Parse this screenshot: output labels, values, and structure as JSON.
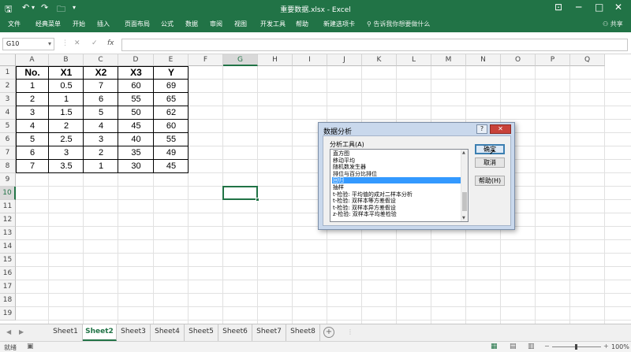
{
  "title": "重要数据.xlsx  -  Excel",
  "quick_access": {
    "save": "🖫",
    "undo": "↶",
    "redo": "↷",
    "more": "▾"
  },
  "window_controls": {
    "ribbon_opts": "⊡",
    "minimize": "─",
    "maximize": "□",
    "close": "✕"
  },
  "ribbon_tabs": [
    "文件",
    "经典菜单",
    "开始",
    "插入",
    "页面布局",
    "公式",
    "数据",
    "审阅",
    "视图",
    "开发工具",
    "帮助",
    "新建选项卡"
  ],
  "tell_me": "告诉我你想要做什么",
  "share": "共享",
  "formula_bar": {
    "name_box": "G10",
    "cancel": "✕",
    "enter": "✓",
    "fx": "fx",
    "formula": ""
  },
  "columns": [
    "A",
    "B",
    "C",
    "D",
    "E",
    "F",
    "G",
    "H",
    "I",
    "J",
    "K",
    "L",
    "M",
    "N",
    "O",
    "P",
    "Q"
  ],
  "rows": [
    "1",
    "2",
    "3",
    "4",
    "5",
    "6",
    "7",
    "8",
    "9",
    "10",
    "11",
    "12",
    "13",
    "14",
    "15",
    "16",
    "17",
    "18",
    "19"
  ],
  "selected_cell": "G10",
  "table": {
    "headers": [
      "No.",
      "X1",
      "X2",
      "X3",
      "Y"
    ],
    "rows": [
      [
        "1",
        "0.5",
        "7",
        "60",
        "69"
      ],
      [
        "2",
        "1",
        "6",
        "55",
        "65"
      ],
      [
        "3",
        "1.5",
        "5",
        "50",
        "62"
      ],
      [
        "4",
        "2",
        "4",
        "45",
        "60"
      ],
      [
        "5",
        "2.5",
        "3",
        "40",
        "55"
      ],
      [
        "6",
        "3",
        "2",
        "35",
        "49"
      ],
      [
        "7",
        "3.5",
        "1",
        "30",
        "45"
      ]
    ]
  },
  "dialog": {
    "title": "数据分析",
    "help": "?",
    "close": "✕",
    "label": "分析工具(A)",
    "tools": [
      "直方图",
      "移动平均",
      "随机数发生器",
      "排位与百分比排位",
      "回归",
      "抽样",
      "t-检验: 平均值的成对二样本分析",
      "t-检验: 双样本等方差假设",
      "t-检验: 双样本异方差假设",
      "z-检验: 双样本平均差检验"
    ],
    "selected_tool": "回归",
    "ok": "确定",
    "cancel": "取消",
    "help_button": "帮助(H)"
  },
  "sheets": [
    "Sheet1",
    "Sheet2",
    "Sheet3",
    "Sheet4",
    "Sheet5",
    "Sheet6",
    "Sheet7",
    "Sheet8"
  ],
  "active_sheet": "Sheet2",
  "status": {
    "ready": "就绪",
    "zoom": "100%"
  },
  "colors": {
    "excel_green": "#217346",
    "selection_blue": "#3399ff"
  }
}
